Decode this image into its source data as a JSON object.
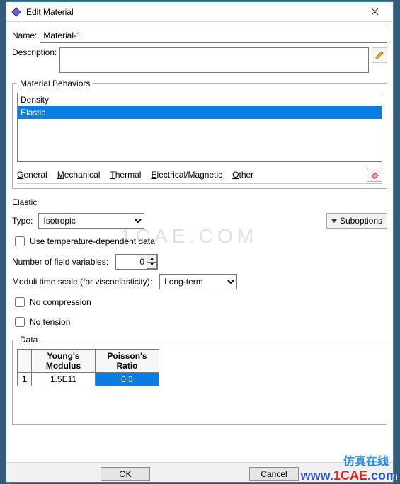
{
  "window": {
    "title": "Edit Material"
  },
  "name_field": {
    "label": "Name:",
    "value": "Material-1"
  },
  "description_field": {
    "label": "Description:",
    "value": ""
  },
  "behaviors": {
    "legend": "Material Behaviors",
    "items": [
      "Density",
      "Elastic"
    ],
    "selected_index": 1
  },
  "menus": {
    "general": "General",
    "mechanical": "Mechanical",
    "thermal": "Thermal",
    "electrical": "Electrical/Magnetic",
    "other": "Other"
  },
  "elastic": {
    "title": "Elastic",
    "type_label": "Type:",
    "type_value": "Isotropic",
    "suboptions_label": "Suboptions",
    "temp_dep_label": "Use temperature-dependent data",
    "temp_dep_checked": false,
    "field_vars_label": "Number of field variables:",
    "field_vars_value": "0",
    "moduli_label": "Moduli time scale (for viscoelasticity):",
    "moduli_value": "Long-term",
    "no_compression_label": "No compression",
    "no_compression_checked": false,
    "no_tension_label": "No tension",
    "no_tension_checked": false
  },
  "data": {
    "legend": "Data",
    "headers": [
      "Young's\nModulus",
      "Poisson's\nRatio"
    ],
    "rows": [
      {
        "index": "1",
        "cells": [
          "1.5E11",
          "0.3"
        ],
        "selected_col": 1
      }
    ]
  },
  "buttons": {
    "ok": "OK",
    "cancel": "Cancel"
  },
  "watermark": {
    "mid": "1CAE.COM",
    "cn": "仿真在线",
    "br_a": "www.",
    "br_b": "1CAE",
    "br_c": ".com"
  }
}
